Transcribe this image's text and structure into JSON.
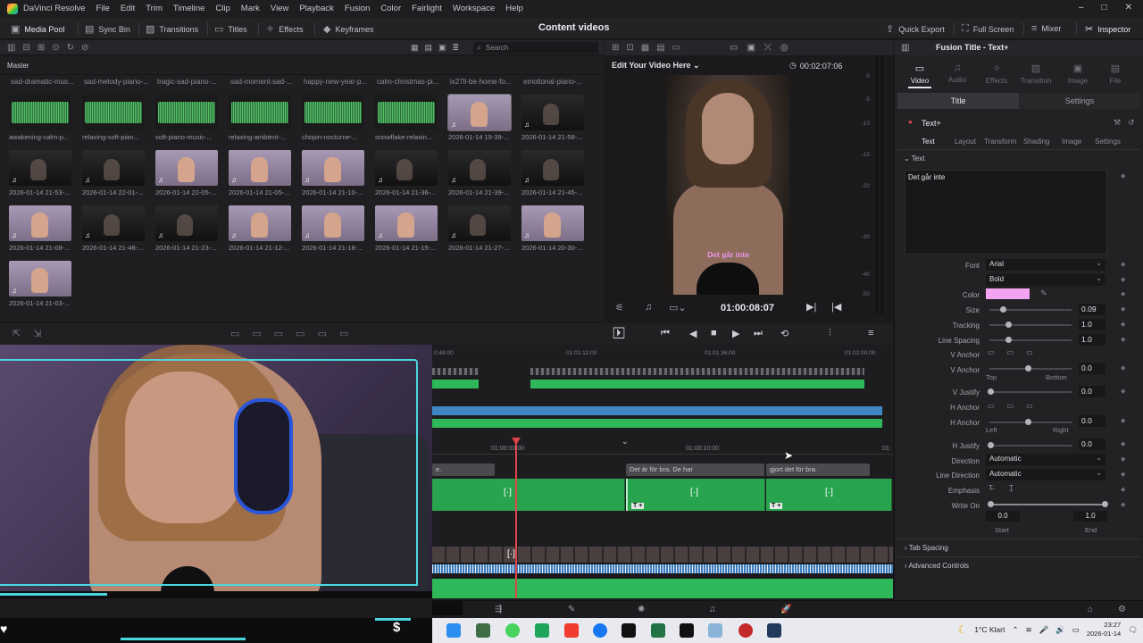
{
  "app": {
    "name": "DaVinci Resolve",
    "menu": [
      "File",
      "Edit",
      "Trim",
      "Timeline",
      "Clip",
      "Mark",
      "View",
      "Playback",
      "Fusion",
      "Color",
      "Fairlight",
      "Workspace",
      "Help"
    ]
  },
  "toolbar": {
    "media_pool": "Media Pool",
    "sync_bin": "Sync Bin",
    "transitions": "Transitions",
    "titles": "Titles",
    "effects": "Effects",
    "keyframes": "Keyframes",
    "project_title": "Content videos",
    "quick_export": "Quick Export",
    "full_screen": "Full Screen",
    "mixer": "Mixer",
    "inspector": "Inspector"
  },
  "media_pool": {
    "search_placeholder": "Search",
    "bin": "Master",
    "top_names": [
      "sad-dramatic-mus...",
      "sad-melody-piano-...",
      "tragic-sad-piano-...",
      "sad-moment-sad-...",
      "happy-new-year-p...",
      "calm-christmas-pi...",
      "ix27ll-be-home-fo...",
      "emotional-piano-..."
    ],
    "clips": [
      {
        "name": "awakening-calm-p...",
        "kind": "audio"
      },
      {
        "name": "relaxing-soft-pian...",
        "kind": "audio"
      },
      {
        "name": "soft-piano-music-...",
        "kind": "audio"
      },
      {
        "name": "relaxing-ambient-...",
        "kind": "audio"
      },
      {
        "name": "chopin-nocturne-...",
        "kind": "audio"
      },
      {
        "name": "snowflake-relaxin...",
        "kind": "audio"
      },
      {
        "name": "2026-01-14 19-39-...",
        "kind": "light"
      },
      {
        "name": "2026-01-14 21-58-...",
        "kind": "dark"
      },
      {
        "name": "2026-01-14 21-53-...",
        "kind": "dark"
      },
      {
        "name": "2026-01-14 22-01-...",
        "kind": "dark"
      },
      {
        "name": "2026-01-14 22-05-...",
        "kind": "light"
      },
      {
        "name": "2026-01-14 21-05-...",
        "kind": "light"
      },
      {
        "name": "2026-01-14 21-10-...",
        "kind": "light"
      },
      {
        "name": "2026-01-14 21-36-...",
        "kind": "dark"
      },
      {
        "name": "2026-01-14 21-39-...",
        "kind": "dark"
      },
      {
        "name": "2026-01-14 21-45-...",
        "kind": "dark"
      },
      {
        "name": "2026-01-14 21-08-...",
        "kind": "light"
      },
      {
        "name": "2026-01-14 21-48-...",
        "kind": "dark"
      },
      {
        "name": "2026-01-14 21-23-...",
        "kind": "dark"
      },
      {
        "name": "2026-01-14 21-12-...",
        "kind": "light"
      },
      {
        "name": "2026-01-14 21-18-...",
        "kind": "light"
      },
      {
        "name": "2026-01-14 21-15-...",
        "kind": "light"
      },
      {
        "name": "2026-01-14 21-27-...",
        "kind": "dark"
      },
      {
        "name": "2026-01-14 20-30-...",
        "kind": "light"
      },
      {
        "name": "2026-01-14 21-03-...",
        "kind": "light"
      }
    ]
  },
  "viewer": {
    "title": "Edit Your Video Here",
    "duration": "00:02:07:06",
    "subtitle": "Det går inte",
    "timecode": "01:00:08:07",
    "meter_ticks": [
      "0",
      "-5",
      "-10",
      "-15",
      "-20",
      "-30",
      "-40",
      "-50"
    ]
  },
  "timeline": {
    "ruler_top": [
      "0:48:00",
      "01:01:12:00",
      "01:01:36:00",
      "01:02:00:00"
    ],
    "ruler_zoom": [
      "01:00:00:00",
      "01:00:10:00",
      "01:"
    ],
    "text_clips": [
      "e.",
      "Det är för bra. De har",
      "gjort det för bra."
    ]
  },
  "inspector": {
    "title": "Fusion Title - Text+",
    "tabs": [
      "Video",
      "Audio",
      "Effects",
      "Transition",
      "Image",
      "File"
    ],
    "subtabs": [
      "Title",
      "Settings"
    ],
    "node": "Text+",
    "text_tabs": [
      "Text",
      "Layout",
      "Transform",
      "Shading",
      "Image",
      "Settings"
    ],
    "section_text": "Text",
    "text_value": "Det går inte",
    "font_label": "Font",
    "font": "Arial",
    "style": "Bold",
    "color_label": "Color",
    "color": "#f3a3ef",
    "size_label": "Size",
    "size": "0.09",
    "tracking_label": "Tracking",
    "tracking": "1.0",
    "line_spacing_label": "Line Spacing",
    "line_spacing": "1.0",
    "v_anchor_label": "V Anchor",
    "v_anchor_slider_label": "V Anchor",
    "v_anchor": "0.0",
    "top_label": "Top",
    "bottom_label": "Bottom",
    "v_justify_label": "V Justify",
    "v_justify": "0.0",
    "h_anchor_label": "H Anchor",
    "h_anchor_slider_label": "H Anchor",
    "h_anchor": "0.0",
    "left_label": "Left",
    "right_label": "Right",
    "h_justify_label": "H Justify",
    "h_justify": "0.0",
    "direction_label": "Direction",
    "direction": "Automatic",
    "line_direction_label": "Line Direction",
    "line_direction": "Automatic",
    "emphasis_label": "Emphasis",
    "write_on_label": "Write On",
    "write_on_start": "0.0",
    "write_on_end": "1.0",
    "start_label": "Start",
    "end_label": "End",
    "tab_spacing": "Tab Spacing",
    "advanced_controls": "Advanced Controls"
  },
  "taskbar": {
    "weather": "1°C Klart",
    "time": "23:27",
    "date": "2026-01-14"
  }
}
